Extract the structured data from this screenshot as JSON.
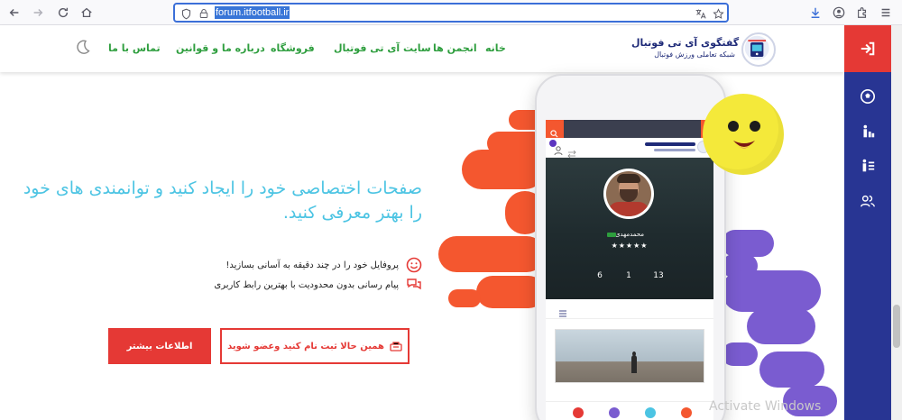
{
  "browser": {
    "url": "forum.itfootball.ir"
  },
  "header": {
    "site_title": "تالار گفتگوی آی تی فوتبال",
    "site_subtitle": "شبکه تعاملی ورزش فوتبال",
    "menu": [
      {
        "label": "خانه"
      },
      {
        "label": "انجمن ها"
      },
      {
        "label": "سایت آی تی فوتبال"
      },
      {
        "label": "فروشگاه"
      },
      {
        "label": "درباره ما و قوانین"
      },
      {
        "label": "تماس با ما"
      }
    ]
  },
  "hero": {
    "title": "صفحات اختصاصی خود را ایجاد کنید و توانمندی های خود را بهتر معرفی کنید.",
    "features": [
      {
        "text": "پروفایل خود را در چند دقیقه به آسانی بسازید!",
        "icon": "smile-icon"
      },
      {
        "text": "پیام رسانی بدون محدودیت با بهترین رابط کاربری",
        "icon": "chat-bubbles-icon"
      }
    ],
    "cta_join": "همین حالا ثبت نام کنید وعضو شوید",
    "cta_more": "اطلاعات بیشتر"
  },
  "phone_mockup": {
    "profile_name": "محمدمهدی",
    "stars": "★★★★★",
    "stats": [
      {
        "value": "13"
      },
      {
        "value": "1"
      },
      {
        "value": "6"
      }
    ]
  },
  "colors": {
    "primary_red": "#e53935",
    "menu_green": "#2e9e3e",
    "hero_blue": "#4cc4e3",
    "sidebar_navy": "#283593",
    "blob_orange": "#f4572f",
    "blob_purple": "#7a5cd0"
  },
  "watermark": "Activate Windows"
}
